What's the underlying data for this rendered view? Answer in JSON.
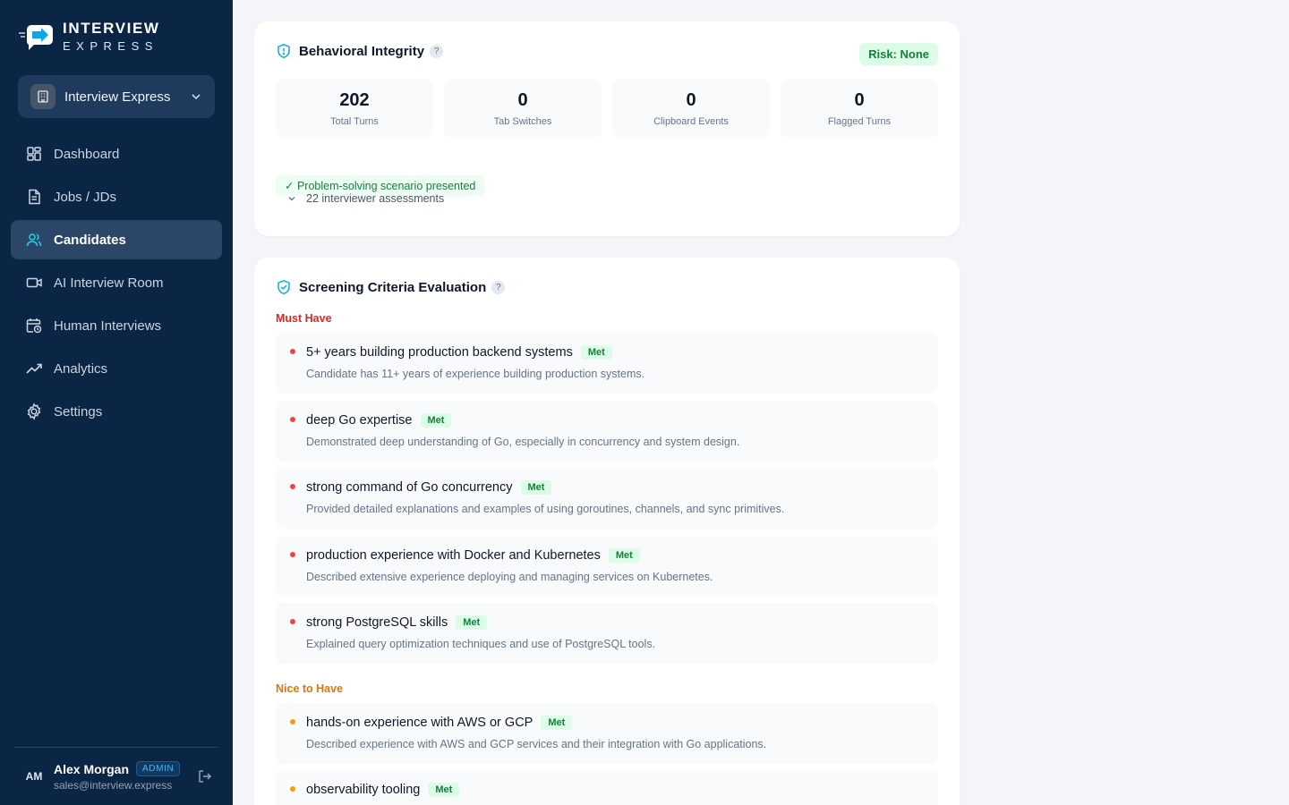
{
  "brand": {
    "name": "INTERVIEW",
    "sub": "EXPRESS"
  },
  "org": {
    "label": "Interview Express"
  },
  "nav": [
    {
      "label": "Dashboard",
      "icon": "grid-icon"
    },
    {
      "label": "Jobs / JDs",
      "icon": "document-icon"
    },
    {
      "label": "Candidates",
      "icon": "users-icon",
      "active": true
    },
    {
      "label": "AI Interview Room",
      "icon": "video-icon"
    },
    {
      "label": "Human Interviews",
      "icon": "calendar-clock-icon"
    },
    {
      "label": "Analytics",
      "icon": "trending-up-icon"
    },
    {
      "label": "Settings",
      "icon": "gear-icon"
    }
  ],
  "user": {
    "initials": "AM",
    "name": "Alex Morgan",
    "role": "ADMIN",
    "email": "sales@interview.express"
  },
  "integrity": {
    "title": "Behavioral Integrity",
    "help": "?",
    "risk": "Risk: None",
    "stats": [
      {
        "value": "202",
        "label": "Total Turns"
      },
      {
        "value": "0",
        "label": "Tab Switches"
      },
      {
        "value": "0",
        "label": "Clipboard Events"
      },
      {
        "value": "0",
        "label": "Flagged Turns"
      }
    ],
    "scenario": "✓ Problem-solving scenario presented",
    "assessments": "22 interviewer assessments"
  },
  "screening": {
    "title": "Screening Criteria Evaluation",
    "help": "?",
    "must_label": "Must Have",
    "nice_label": "Nice to Have",
    "must": [
      {
        "title": "5+ years building production backend systems",
        "status": "Met",
        "desc": "Candidate has 11+ years of experience building production systems."
      },
      {
        "title": "deep Go expertise",
        "status": "Met",
        "desc": "Demonstrated deep understanding of Go, especially in concurrency and system design."
      },
      {
        "title": "strong command of Go concurrency",
        "status": "Met",
        "desc": "Provided detailed explanations and examples of using goroutines, channels, and sync primitives."
      },
      {
        "title": "production experience with Docker and Kubernetes",
        "status": "Met",
        "desc": "Described extensive experience deploying and managing services on Kubernetes."
      },
      {
        "title": "strong PostgreSQL skills",
        "status": "Met",
        "desc": "Explained query optimization techniques and use of PostgreSQL tools."
      }
    ],
    "nice": [
      {
        "title": "hands-on experience with AWS or GCP",
        "status": "Met",
        "desc": "Described experience with AWS and GCP services and their integration with Go applications."
      },
      {
        "title": "observability tooling",
        "status": "Met",
        "desc": ""
      }
    ]
  },
  "colors": {
    "sidebar": "#0b2545",
    "accent": "#22d3ee",
    "must": "#dc2626",
    "nice": "#d97706",
    "met_bg": "#dcfce7",
    "met_text": "#15803d"
  }
}
